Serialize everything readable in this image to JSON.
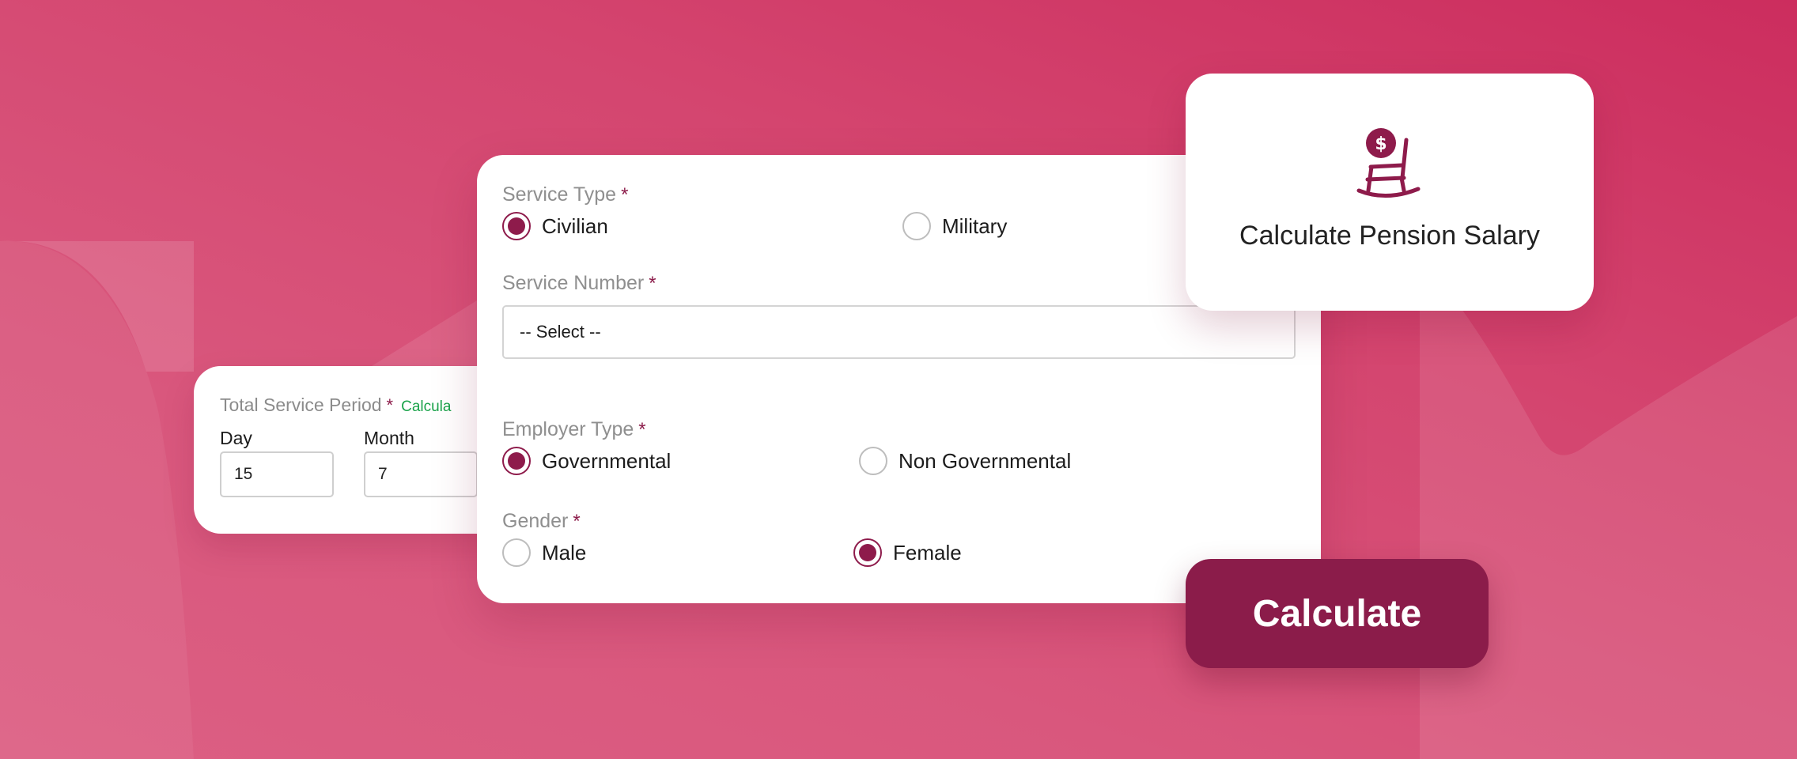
{
  "theme": {
    "accent": "#8e1b4b",
    "success": "#1aa34a",
    "background": "#d4456f"
  },
  "period_card": {
    "title": "Total Service Period",
    "required_mark": "*",
    "link_text": "Calcula",
    "day_label": "Day",
    "day_value": "15",
    "month_label": "Month",
    "month_value": "7"
  },
  "form": {
    "service_type": {
      "label": "Service Type",
      "required_mark": "*",
      "options": [
        {
          "label": "Civilian",
          "selected": true
        },
        {
          "label": "Military",
          "selected": false
        }
      ]
    },
    "service_number": {
      "label": "Service Number",
      "required_mark": "*",
      "selected_value": "-- Select --"
    },
    "employer_type": {
      "label": "Employer Type",
      "required_mark": "*",
      "options": [
        {
          "label": "Governmental",
          "selected": true
        },
        {
          "label": "Non Governmental",
          "selected": false
        }
      ]
    },
    "gender": {
      "label": "Gender",
      "required_mark": "*",
      "options": [
        {
          "label": "Male",
          "selected": false
        },
        {
          "label": "Female",
          "selected": true
        }
      ]
    }
  },
  "pension_card": {
    "icon": "rocking-chair-dollar-icon",
    "title": "Calculate Pension Salary"
  },
  "actions": {
    "calculate_label": "Calculate"
  }
}
